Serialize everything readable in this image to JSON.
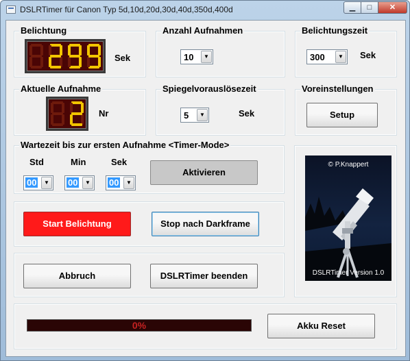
{
  "window": {
    "title": "DSLRTimer für Canon Typ 5d,10d,20d,30d,40d,350d,400d",
    "icon": "app-window-icon",
    "minimize_symbol": "▁",
    "maximize_symbol": "□",
    "close_symbol": "✕"
  },
  "belichtung": {
    "legend": "Belichtung",
    "display_digits": "0299",
    "display_lit": [
      false,
      true,
      true,
      true
    ],
    "unit": "Sek"
  },
  "aktuelle": {
    "legend": "Aktuelle Aufnahme",
    "display_digits": "02",
    "display_lit": [
      false,
      true
    ],
    "unit": "Nr"
  },
  "anzahl": {
    "legend": "Anzahl Aufnahmen",
    "selected": "10"
  },
  "spiegel": {
    "legend": "Spiegelvorauslösezeit",
    "selected": "5",
    "unit": "Sek"
  },
  "belichtungszeit": {
    "legend": "Belichtungszeit",
    "selected": "300",
    "unit": "Sek"
  },
  "voreinstellungen": {
    "legend": "Voreinstellungen",
    "setup_label": "Setup"
  },
  "wartezeit": {
    "legend": "Wartezeit bis zur ersten Aufnahme <Timer-Mode>",
    "std_label": "Std",
    "min_label": "Min",
    "sek_label": "Sek",
    "std_value": "00",
    "min_value": "00",
    "sek_value": "00",
    "activate_label": "Aktivieren"
  },
  "actions": {
    "start_label": "Start  Belichtung",
    "stop_label": "Stop nach Darkframe",
    "abort_label": "Abbruch",
    "quit_label": "DSLRTimer beenden",
    "reset_label": "Akku Reset"
  },
  "photo": {
    "copyright": "© P.Knappert",
    "version": "DSLRTimer Version 1.0"
  },
  "progress": {
    "text": "0%",
    "value": 0
  },
  "colors": {
    "led_on": "#f2c400",
    "led_off": "#6e1a0c",
    "start_button": "#ff1a1a",
    "progress_text": "#c52121"
  }
}
